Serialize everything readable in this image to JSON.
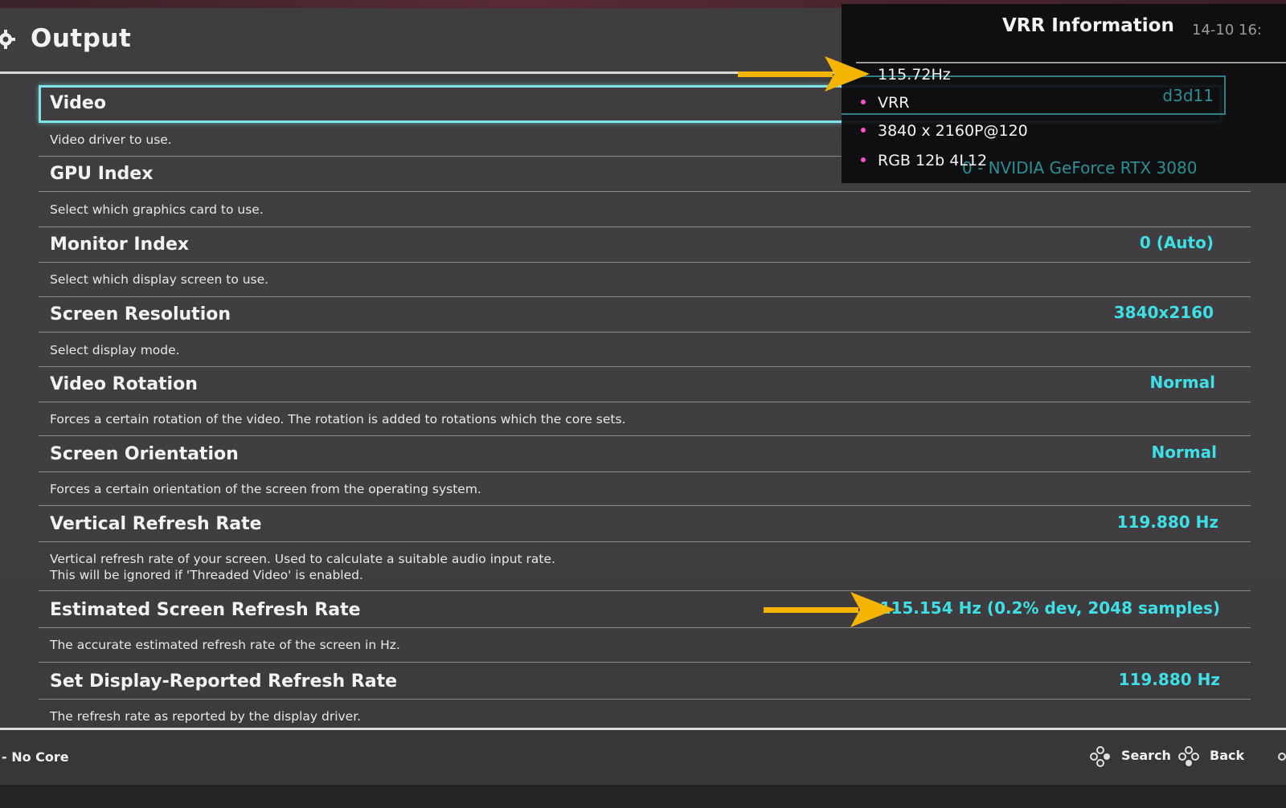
{
  "header": {
    "title": "Output",
    "icon": "gear-icon"
  },
  "settings": [
    {
      "label": "Video",
      "value": "",
      "description": "Video driver to use."
    },
    {
      "label": "GPU Index",
      "value": "",
      "description": "Select which graphics card to use."
    },
    {
      "label": "Monitor Index",
      "value": "0 (Auto)",
      "description": "Select which display screen to use."
    },
    {
      "label": "Screen Resolution",
      "value": "3840x2160",
      "description": "Select display mode."
    },
    {
      "label": "Video Rotation",
      "value": "Normal",
      "description": "Forces a certain rotation of the video. The rotation is added to rotations which the core sets."
    },
    {
      "label": "Screen Orientation",
      "value": "Normal",
      "description": "Forces a certain orientation of the screen from the operating system."
    },
    {
      "label": "Vertical Refresh Rate",
      "value": "119.880 Hz",
      "description": "Vertical refresh rate of your screen. Used to calculate a suitable audio input rate.",
      "description2": "This will be ignored if 'Threaded Video' is enabled."
    },
    {
      "label": "Estimated Screen Refresh Rate",
      "value": "115.154 Hz (0.2% dev, 2048 samples)",
      "description": "The accurate estimated refresh rate of the screen in Hz."
    },
    {
      "label": "Set Display-Reported Refresh Rate",
      "value": "119.880 Hz",
      "description": "The refresh rate as reported by the display driver."
    }
  ],
  "hidden_values": {
    "video_driver": "d3d11",
    "gpu": "0 - NVIDIA GeForce RTX 3080"
  },
  "vrr_overlay": {
    "title": "VRR Information",
    "date": "14-10 16:",
    "refresh": "115.72Hz",
    "items": [
      "VRR",
      "3840 x 2160P@120",
      "RGB 12b 4L12"
    ]
  },
  "footer": {
    "core": "- No Core",
    "search_label": "Search",
    "back_label": "Back"
  },
  "colors": {
    "value": "#3ee0e6",
    "selection": "#7fe3e8",
    "arrow": "#f5b400",
    "bullet": "#ff4fd2"
  }
}
